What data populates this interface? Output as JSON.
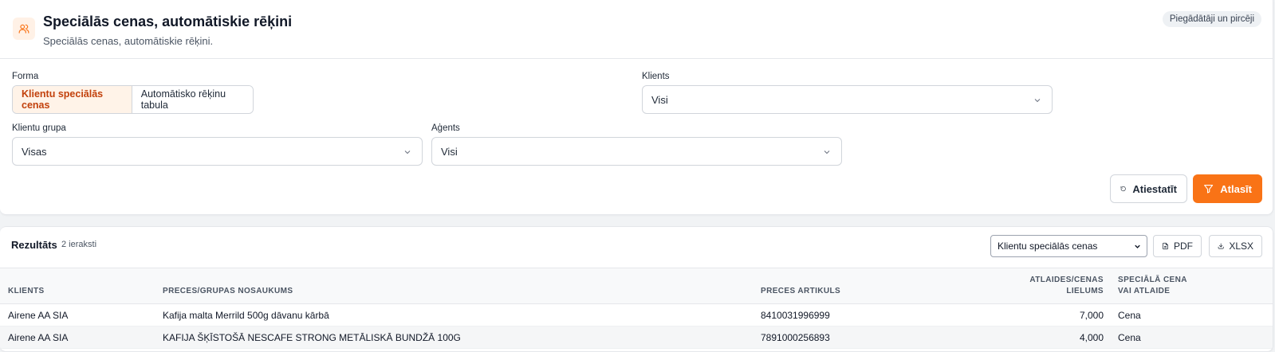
{
  "header": {
    "title": "Speciālās cenas, automātiskie rēķini",
    "subtitle": "Speciālās cenas, automātiskie rēķini.",
    "badge": "Piegādātāji un pircēji",
    "icon": "users-icon"
  },
  "filters": {
    "forma": {
      "label": "Forma",
      "options": [
        "Klientu speciālās cenas",
        "Automātisko rēķinu tabula"
      ],
      "active": "Klientu speciālās cenas"
    },
    "klients": {
      "label": "Klients",
      "value": "Visi"
    },
    "klientu_grupa": {
      "label": "Klientu grupa",
      "value": "Visas"
    },
    "agents": {
      "label": "Aģents",
      "value": "Visi"
    },
    "reset_label": "Atiestatīt",
    "apply_label": "Atlasīt"
  },
  "results": {
    "title": "Rezultāts",
    "count": "2 ieraksti",
    "report_select": "Klientu speciālās cenas",
    "pdf_label": "PDF",
    "xlsx_label": "XLSX",
    "columns": {
      "klients": "KLIENTS",
      "nosaukums": "PRECES/GRUPAS NOSAUKUMS",
      "artikuls": "PRECES ARTIKULS",
      "lielums_1": "ATLAIDES/CENAS",
      "lielums_2": "LIELUMS",
      "veids_1": "SPECIĀLĀ CENA",
      "veids_2": "VAI ATLAIDE"
    },
    "rows": [
      {
        "klients": "Airene AA SIA",
        "nosaukums": "Kafija malta Merrild 500g dāvanu kārbā",
        "artikuls": "8410031996999",
        "lielums": "7,000",
        "veids": "Cena"
      },
      {
        "klients": "Airene AA SIA",
        "nosaukums": "KAFIJA ŠĶĪSTOŠĀ NESCAFE STRONG METĀLISKĀ BUNDŽĀ 100G",
        "artikuls": "7891000256893",
        "lielums": "4,000",
        "veids": "Cena"
      }
    ]
  },
  "colors": {
    "accent": "#f97316",
    "accent_soft": "#fff3e8",
    "accent_text": "#c2410c"
  }
}
